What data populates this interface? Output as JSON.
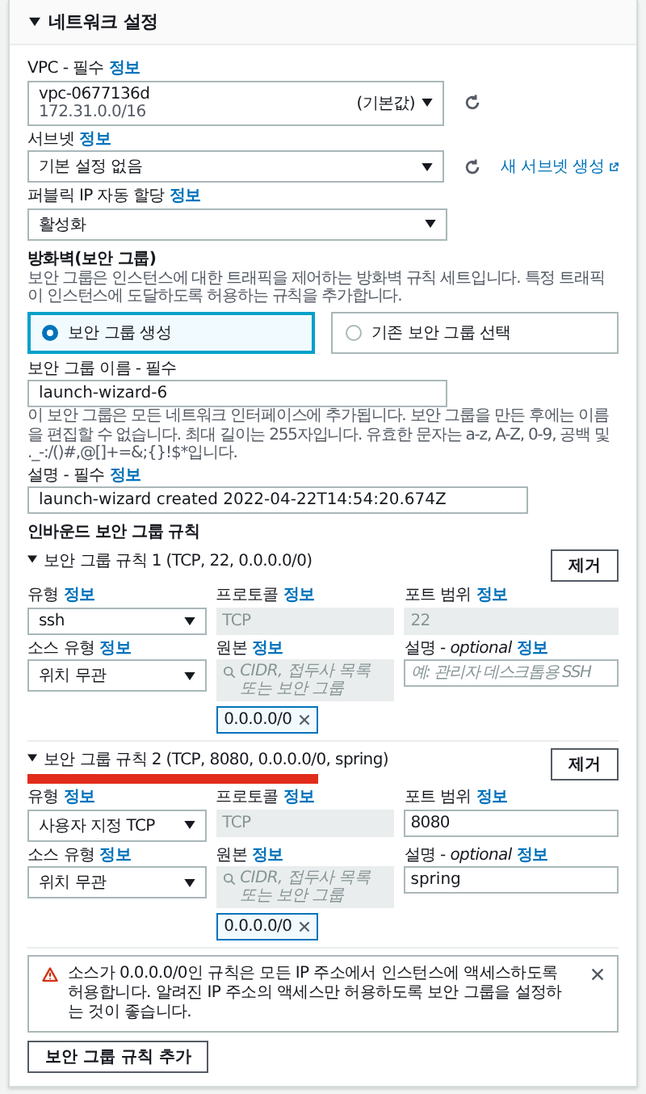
{
  "section": {
    "title": "네트워크 설정",
    "expanded": true
  },
  "vpc": {
    "label": "VPC - 필수",
    "info": "정보",
    "value": "vpc-0677136d",
    "tag": "(기본값)",
    "sub": "172.31.0.0/16"
  },
  "subnet": {
    "label": "서브넷",
    "info": "정보",
    "value": "기본 설정 없음",
    "link": "새 서브넷 생성"
  },
  "public_ip": {
    "label": "퍼블릭 IP 자동 할당",
    "info": "정보",
    "value": "활성화"
  },
  "firewall": {
    "title": "방화벽(보안 그룹)",
    "description": "보안 그룹은 인스턴스에 대한 트래픽을 제어하는 방화벽 규칙 세트입니다. 특정 트래픽이 인스턴스에 도달하도록 허용하는 규칙을 추가합니다.",
    "options": [
      {
        "label": "보안 그룹 생성",
        "selected": true
      },
      {
        "label": "기존 보안 그룹 선택",
        "selected": false
      }
    ]
  },
  "sg_name": {
    "label": "보안 그룹 이름 - 필수",
    "value": "launch-wizard-6",
    "hint": "이 보안 그룹은 모든 네트워크 인터페이스에 추가됩니다. 보안 그룹을 만든 후에는 이름을 편집할 수 없습니다. 최대 길이는 255자입니다. 유효한 문자는 a-z, A-Z, 0-9, 공백 및 ._-:/()#,@[]+=&;{}!$*입니다."
  },
  "sg_desc": {
    "label": "설명 - 필수",
    "info": "정보",
    "value": "launch-wizard created 2022-04-22T14:54:20.674Z"
  },
  "inbound_title": "인바운드 보안 그룹 규칙",
  "rules": [
    {
      "title": "보안 그룹 규칙 1 (TCP, 22, 0.0.0.0/0)",
      "expanded": true,
      "redacted": false,
      "remove": "제거",
      "type_label": "유형",
      "type_info": "정보",
      "type_value": "ssh",
      "protocol_label": "프로토콜",
      "protocol_info": "정보",
      "protocol_value": "TCP",
      "port_label": "포트 범위",
      "port_info": "정보",
      "port_value": "22",
      "port_disabled": true,
      "source_type_label": "소스 유형",
      "source_type_info": "정보",
      "source_type_value": "위치 무관",
      "source_label": "원본",
      "source_info": "정보",
      "source_placeholder": "CIDR, 접두사 목록 또는 보안 그룹",
      "source_token": "0.0.0.0/0",
      "desc_label": "설명 - *optional*",
      "desc_info": "정보",
      "desc_placeholder": "예: 관리자 데스크톱용 SSH"
    },
    {
      "title": "보안 그룹 규칙 2 (TCP, 8080, 0.0.0.0/0, spring)",
      "expanded": true,
      "redacted": true,
      "remove": "제거",
      "type_label": "유형",
      "type_info": "정보",
      "type_value": "사용자 지정 TCP",
      "protocol_label": "프로토콜",
      "protocol_info": "정보",
      "protocol_value": "TCP",
      "port_label": "포트 범위",
      "port_info": "정보",
      "port_value": "8080",
      "port_disabled": false,
      "source_type_label": "소스 유형",
      "source_type_info": "정보",
      "source_type_value": "위치 무관",
      "source_label": "원본",
      "source_info": "정보",
      "source_placeholder": "CIDR, 접두사 목록 또는 보안 그룹",
      "source_token": "0.0.0.0/0",
      "desc_label": "설명 - *optional*",
      "desc_info": "정보",
      "desc_value": "spring"
    }
  ],
  "warning": {
    "text": "소스가 0.0.0.0/0인 규칙은 모든 IP 주소에서 인스턴스에 액세스하도록 허용합니다. 알려진 IP 주소의 액세스만 허용하도록 보안 그룹을 설정하는 것이 좋습니다."
  },
  "add_button": "보안 그룹 규칙 추가"
}
